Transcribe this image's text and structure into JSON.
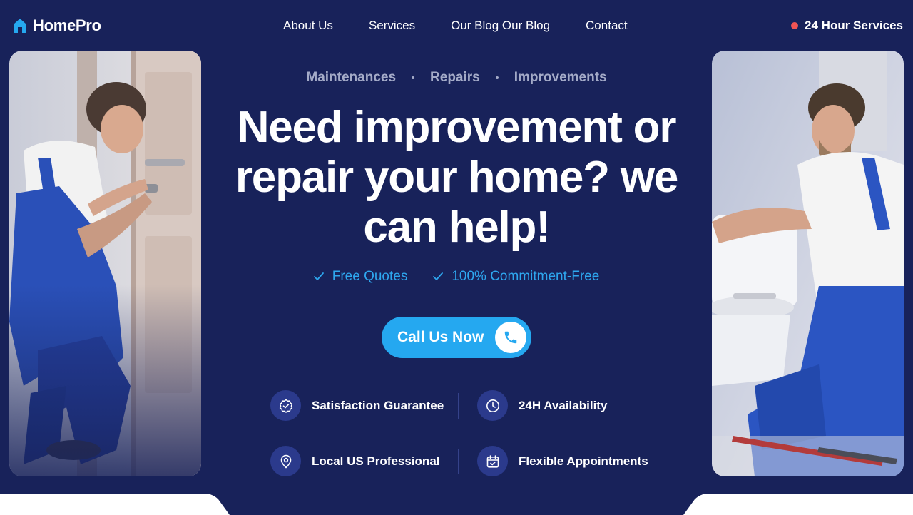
{
  "brand": {
    "name": "HomePro",
    "accent": "#25a8f0",
    "background": "#18225a"
  },
  "nav": {
    "items": [
      "About Us",
      "Services",
      "Our Blog Our Blog",
      "Contact"
    ]
  },
  "header_badge": {
    "label": "24 Hour Services",
    "dot_color": "#f15454"
  },
  "hero": {
    "categories": [
      "Maintenances",
      "Repairs",
      "Improvements"
    ],
    "title": "Need improvement or repair your home? we can help!",
    "checks": [
      "Free Quotes",
      "100% Commitment-Free"
    ],
    "cta_label": "Call Us Now"
  },
  "features": [
    {
      "label": "Satisfaction Guarantee",
      "icon": "badge-check-icon"
    },
    {
      "label": "24H Availability",
      "icon": "clock-icon"
    },
    {
      "label": "Local US Professional",
      "icon": "map-pin-icon"
    },
    {
      "label": "Flexible Appointments",
      "icon": "calendar-check-icon"
    }
  ],
  "images": {
    "left": "technician-fixing-door-lock-photo",
    "right": "plumber-repairing-toilet-photo"
  }
}
